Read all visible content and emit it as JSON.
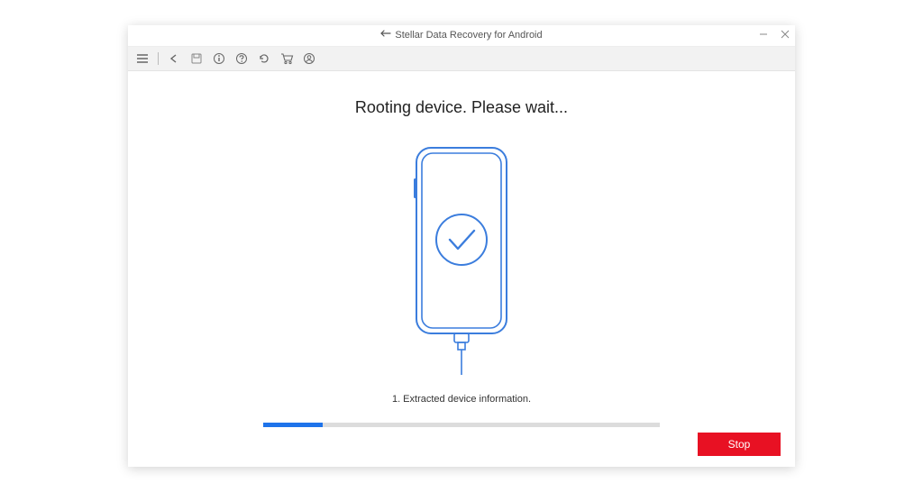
{
  "window": {
    "title": "Stellar Data Recovery for Android"
  },
  "main": {
    "heading": "Rooting device. Please wait...",
    "status": "1. Extracted device information.",
    "progress_percent": 15
  },
  "buttons": {
    "stop": "Stop"
  },
  "colors": {
    "accent": "#1e73ea",
    "danger": "#e81123",
    "phone_outline": "#3b7ddd"
  }
}
